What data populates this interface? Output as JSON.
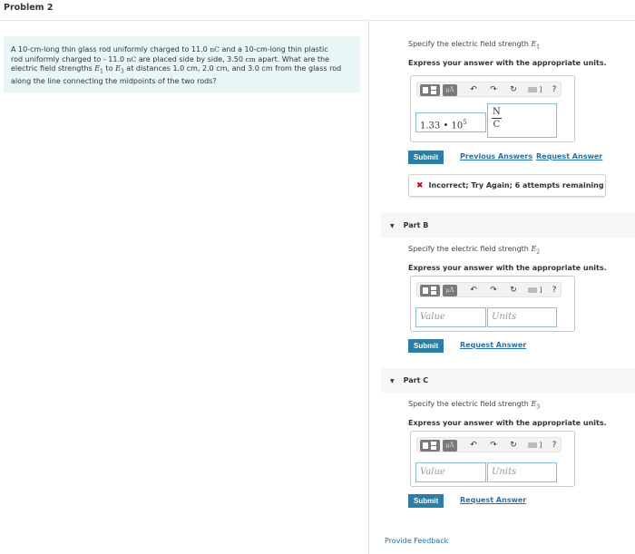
{
  "problem": {
    "title": "Problem 2",
    "text_line1_pre": "A 10-cm-long thin glass rod uniformly charged to 11.0",
    "text_line1_unit1": "nC",
    "text_line1_post": "and a 10-cm-long thin plastic",
    "text_line2_pre": "rod uniformly charged to - 11.0",
    "text_line2_unit": "nC",
    "text_line2_mid": "are placed side by side, 3.50",
    "text_line2_unit2": "cm",
    "text_line2_post": "apart. What are the",
    "text_line3_pre": "electric field strengths",
    "E1_sym": "E",
    "E1_sub": "1",
    "text_line3_to": "to",
    "E3_sym": "E",
    "E3_sub": "3",
    "text_line3_post": "at distances 1.0 cm, 2.0 cm, and 3.0 cm from the glass rod",
    "text_line4": "along the line connecting the midpoints of the two rods?"
  },
  "toolbar": {
    "templates_icon": "templates-icon",
    "units_label": "μÅ",
    "undo": "↶",
    "redo": "↷",
    "reset": "↻",
    "keyboard_bracket": "]",
    "help": "?"
  },
  "partA": {
    "prompt": "Specify the electric field strength",
    "sym": "E",
    "sub": "1",
    "instruction": "Express your answer with the appropriate units.",
    "value_mantissa": "1.33 • 10",
    "value_exponent": "5",
    "unit_numerator": "N",
    "unit_denominator": "C",
    "submit": "Submit",
    "previous_answers": "Previous Answers",
    "request_answer": "Request Answer",
    "feedback": "Incorrect; Try Again; 6 attempts remaining",
    "feedback_icon": "✖"
  },
  "partB": {
    "header": "Part B",
    "caret": "▼",
    "prompt": "Specify the electric field strength",
    "sym": "E",
    "sub": "2",
    "instruction": "Express your answer with the appropriate units.",
    "value_placeholder": "Value",
    "units_placeholder": "Units",
    "submit": "Submit",
    "request_answer": "Request Answer"
  },
  "partC": {
    "header": "Part C",
    "caret": "▼",
    "prompt": "Specify the electric field strength",
    "sym": "E",
    "sub": "3",
    "instruction": "Express your answer with the appropriate units.",
    "value_placeholder": "Value",
    "units_placeholder": "Units",
    "submit": "Submit",
    "request_answer": "Request Answer"
  },
  "footer": {
    "provide_feedback": "Provide Feedback"
  }
}
